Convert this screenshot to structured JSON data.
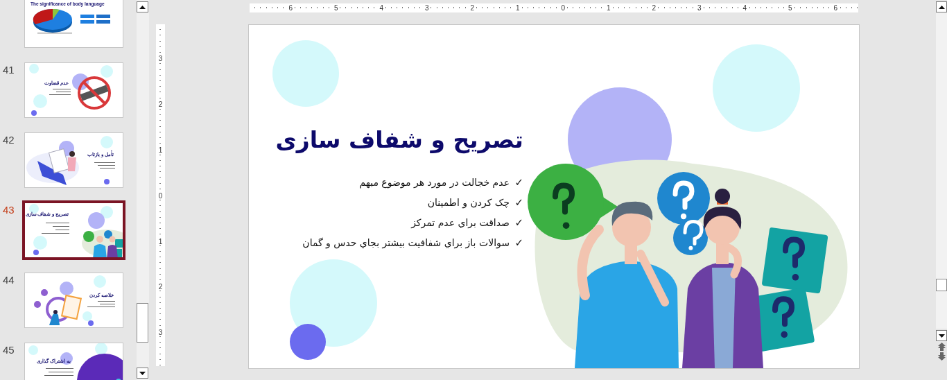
{
  "thumbnails": [
    {
      "title": "The significance of body language",
      "kind": "chart",
      "selected": false
    },
    {
      "number": "41",
      "title": "عدم قضاوت",
      "kind": "judgement",
      "selected": false
    },
    {
      "number": "42",
      "title": "تأمل و بازتاب",
      "kind": "reflection",
      "selected": false
    },
    {
      "number": "43",
      "title": "تصریح و شفاف سازی",
      "kind": "people",
      "selected": true
    },
    {
      "number": "44",
      "title": "خلاصه کردن",
      "kind": "summary",
      "selected": false
    },
    {
      "number": "45",
      "title": "به اشتراک گذاری",
      "kind": "sharing",
      "selected": false
    }
  ],
  "ruler": {
    "horizontal": [
      "6",
      "5",
      "4",
      "3",
      "2",
      "1",
      "0",
      "1",
      "2",
      "3",
      "4",
      "5",
      "6"
    ],
    "vertical": [
      "3",
      "2",
      "1",
      "0",
      "1",
      "2",
      "3"
    ]
  },
  "slide": {
    "title": "تصریح و شفاف سازی",
    "bullets": [
      {
        "mark": "✓",
        "text": "عدم خجالت در مورد هر موضوع مبهم"
      },
      {
        "mark": "✓",
        "text": "چک کردن و اطمینان"
      },
      {
        "mark": "✓",
        "text": "صداقت براي عدم تمرکز"
      },
      {
        "mark": "✓",
        "text": "سوالات باز براي شفافيت بيشتر بجاي حدس و گمان"
      }
    ]
  }
}
